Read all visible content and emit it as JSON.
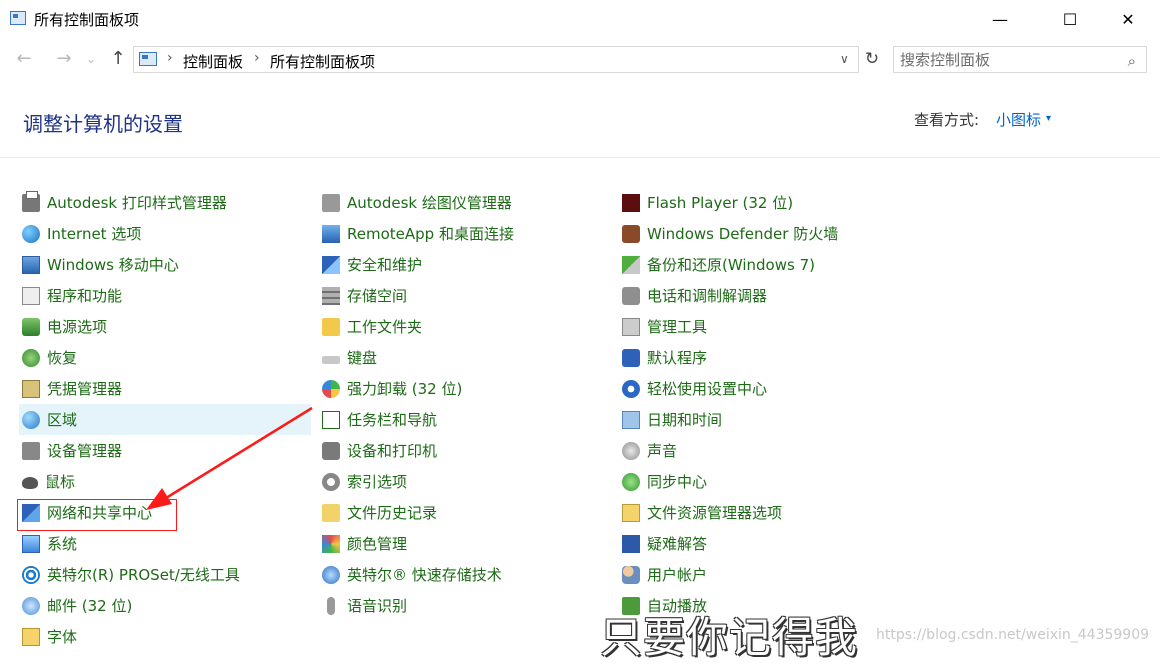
{
  "window": {
    "title": "所有控制面板项",
    "minimize_glyph": "—",
    "maximize_glyph": "☐",
    "close_glyph": "✕"
  },
  "nav": {
    "back_glyph": "←",
    "forward_glyph": "→",
    "recent_glyph": "⌄",
    "up_glyph": "↑",
    "refresh_glyph": "↻",
    "dropdown_glyph": "∨"
  },
  "address": {
    "separator": "›",
    "crumbs": [
      "控制面板",
      "所有控制面板项"
    ]
  },
  "search": {
    "placeholder": "搜索控制面板",
    "icon_glyph": "⌕"
  },
  "header": {
    "title": "调整计算机的设置",
    "view_by_label": "查看方式:",
    "view_by_value": "小图标",
    "caret": "▾"
  },
  "items": [
    {
      "label": "Autodesk 打印样式管理器",
      "icon": "printer-icon"
    },
    {
      "label": "Internet 选项",
      "icon": "globe-icon"
    },
    {
      "label": "Windows 移动中心",
      "icon": "mobility-icon"
    },
    {
      "label": "程序和功能",
      "icon": "programs-icon"
    },
    {
      "label": "电源选项",
      "icon": "power-icon"
    },
    {
      "label": "恢复",
      "icon": "recovery-icon"
    },
    {
      "label": "凭据管理器",
      "icon": "credential-icon"
    },
    {
      "label": "区域",
      "icon": "region-icon"
    },
    {
      "label": "设备管理器",
      "icon": "device-manager-icon"
    },
    {
      "label": "鼠标",
      "icon": "mouse-icon"
    },
    {
      "label": "网络和共享中心",
      "icon": "network-icon"
    },
    {
      "label": "系统",
      "icon": "system-icon"
    },
    {
      "label": "英特尔(R) PROSet/无线工具",
      "icon": "wireless-icon"
    },
    {
      "label": "邮件 (32 位)",
      "icon": "mail-icon"
    },
    {
      "label": "字体",
      "icon": "font-icon"
    },
    {
      "label": "Autodesk 绘图仪管理器",
      "icon": "plotter-icon"
    },
    {
      "label": "RemoteApp 和桌面连接",
      "icon": "remoteapp-icon"
    },
    {
      "label": "安全和维护",
      "icon": "flag-icon"
    },
    {
      "label": "存储空间",
      "icon": "storage-icon"
    },
    {
      "label": "工作文件夹",
      "icon": "folder-icon"
    },
    {
      "label": "键盘",
      "icon": "keyboard-icon"
    },
    {
      "label": "强力卸载 (32 位)",
      "icon": "uninstall-icon"
    },
    {
      "label": "任务栏和导航",
      "icon": "taskbar-icon"
    },
    {
      "label": "设备和打印机",
      "icon": "devices-printers-icon"
    },
    {
      "label": "索引选项",
      "icon": "index-icon"
    },
    {
      "label": "文件历史记录",
      "icon": "file-history-icon"
    },
    {
      "label": "颜色管理",
      "icon": "color-icon"
    },
    {
      "label": "英特尔® 快速存储技术",
      "icon": "rapid-storage-icon"
    },
    {
      "label": "语音识别",
      "icon": "microphone-icon"
    },
    {
      "label": "Flash Player (32 位)",
      "icon": "flash-icon"
    },
    {
      "label": "Windows Defender 防火墙",
      "icon": "firewall-icon"
    },
    {
      "label": "备份和还原(Windows 7)",
      "icon": "backup-icon"
    },
    {
      "label": "电话和调制解调器",
      "icon": "phone-icon"
    },
    {
      "label": "管理工具",
      "icon": "admin-tools-icon"
    },
    {
      "label": "默认程序",
      "icon": "default-programs-icon"
    },
    {
      "label": "轻松使用设置中心",
      "icon": "ease-of-access-icon"
    },
    {
      "label": "日期和时间",
      "icon": "datetime-icon"
    },
    {
      "label": "声音",
      "icon": "sound-icon"
    },
    {
      "label": "同步中心",
      "icon": "sync-icon"
    },
    {
      "label": "文件资源管理器选项",
      "icon": "explorer-options-icon"
    },
    {
      "label": "疑难解答",
      "icon": "troubleshoot-icon"
    },
    {
      "label": "用户帐户",
      "icon": "users-icon"
    },
    {
      "label": "自动播放",
      "icon": "autoplay-icon"
    }
  ],
  "selected_item": "区域",
  "annotation": {
    "highlighted_item": "网络和共享中心",
    "box_color": "#ff1a1a"
  },
  "watermark": {
    "caption": "只要你记得我",
    "url": "https://blog.csdn.net/weixin_44359909"
  },
  "colors": {
    "link_green": "#1d6b16",
    "heading_blue": "#1e3287",
    "accent_blue": "#0066cc",
    "selection_bg": "#e5f3fb"
  }
}
